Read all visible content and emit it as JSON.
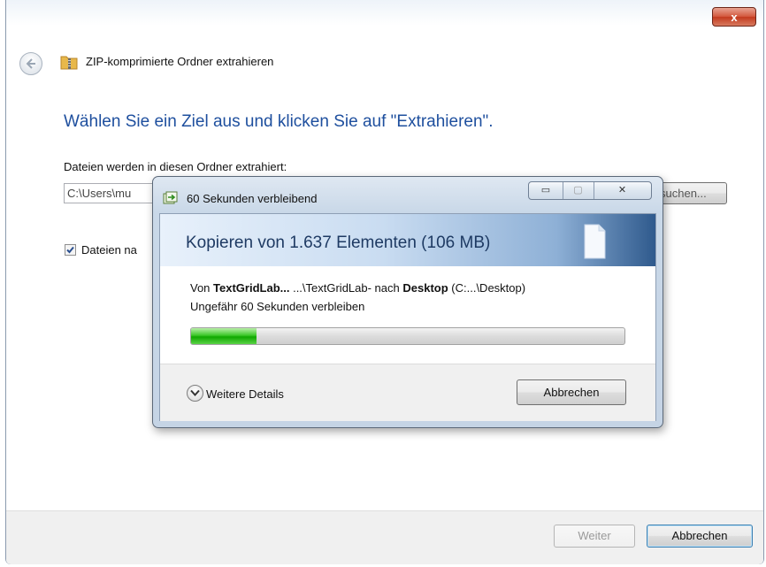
{
  "wizard": {
    "close_glyph": "x",
    "back_icon": "back-arrow-icon",
    "folder_icon": "zip-folder-icon",
    "title": "ZIP-komprimierte Ordner extrahieren",
    "heading": "Wählen Sie ein Ziel aus und klicken Sie auf \"Extrahieren\".",
    "dest_label": "Dateien werden in diesen Ordner extrahiert:",
    "path_value": "C:\\Users\\mu",
    "browse_label": "suchen...",
    "show_files_label": "Dateien na",
    "show_files_checked": true,
    "next_label": "Weiter",
    "next_enabled": false,
    "cancel_label": "Abbrechen"
  },
  "progress_dialog": {
    "icon": "copy-progress-icon",
    "title": "60 Sekunden verbleibend",
    "minimize_glyph": "▭",
    "maximize_glyph": "▢",
    "close_glyph": "✕",
    "banner_title": "Kopieren von 1.637 Elementen (106 MB)",
    "banner_icon": "document-icon",
    "source_prefix": "Von ",
    "source_name": "TextGridLab...",
    "source_path": " ...\\TextGridLab- nach ",
    "dest_name": "Desktop",
    "dest_path": " (C:...\\Desktop)",
    "time_remaining": "Ungefähr 60 Sekunden verbleiben",
    "progress_fraction": 0.15,
    "more_details_label": "Weitere Details",
    "cancel_label": "Abbrechen",
    "colors": {
      "progress_green": "#10a800",
      "heading_blue": "#1e4f9e",
      "banner_dark": "#2f5a8d"
    }
  }
}
